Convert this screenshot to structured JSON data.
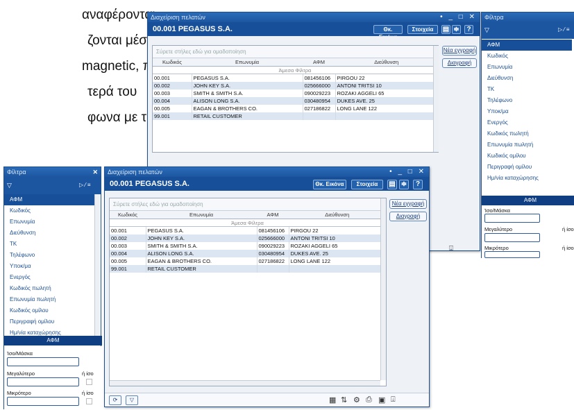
{
  "doc_text": [
    "αναφέρονται",
    "ζονται μέσω",
    "magnetic, που",
    "τερά του",
    "φωνα με τις"
  ],
  "customer_window": {
    "title": "Διαχείριση πελατών",
    "window_controls": "• _ □ ✕",
    "record": "00.001 PEGASUS S.A.",
    "btn_image": "Θκ. Εικόνα",
    "btn_details": "Στοιχεία",
    "group_hint": "Σύρετε στήλες εδώ για ομαδοποίηση",
    "columns": [
      "Κωδικός",
      "Επωνυμία",
      "ΑΦΜ",
      "Διεύθυνση"
    ],
    "filter_row": "Άμεσα Φίλτρα",
    "rows": [
      [
        "00.001",
        "PEGASUS S.A.",
        "081456106",
        "PIRGOU 22"
      ],
      [
        "00.002",
        "JOHN KEY S.A.",
        "025666000",
        "ANTONI TRITSI 10"
      ],
      [
        "00.003",
        "SMITH & SMITH S.A.",
        "090029223",
        "ROZAKI AGGELI 65"
      ],
      [
        "00.004",
        "ALISON LONG S.A.",
        "030480954",
        "DUKES AVE. 25"
      ],
      [
        "00.005",
        "EAGAN & BROTHERS CO.",
        "027186822",
        "LONG LANE 122"
      ],
      [
        "99.001",
        "RETAIL CUSTOMER",
        "",
        ""
      ]
    ],
    "btn_new": "Νέα εγγραφή",
    "btn_delete": "Διαγραφή"
  },
  "filter_panel": {
    "title": "Φίλτρα",
    "items": [
      "ΑΦΜ",
      "Κωδικός",
      "Επωνυμία",
      "Διεύθυνση",
      "ΤΚ",
      "Τηλέφωνο",
      "Υποκ/μα",
      "Ενεργός",
      "Κωδικός πωλητή",
      "Επωνυμία πωλητή",
      "Κωδικός ομίλου",
      "Περιγραφή ομίλου",
      "Ημ/νία καταχώρησης"
    ],
    "section": "ΑΦΜ",
    "label_equal": "Ίσο/Μάσκα",
    "label_greater": "Μεγαλύτερο",
    "label_less": "Μικρότερο",
    "label_or_equal": "ή ίσο"
  },
  "colors": {
    "titlebar": "#1d56a0",
    "header": "#174f98",
    "selected": "#174f98",
    "row_alt": "#dce6f3"
  }
}
